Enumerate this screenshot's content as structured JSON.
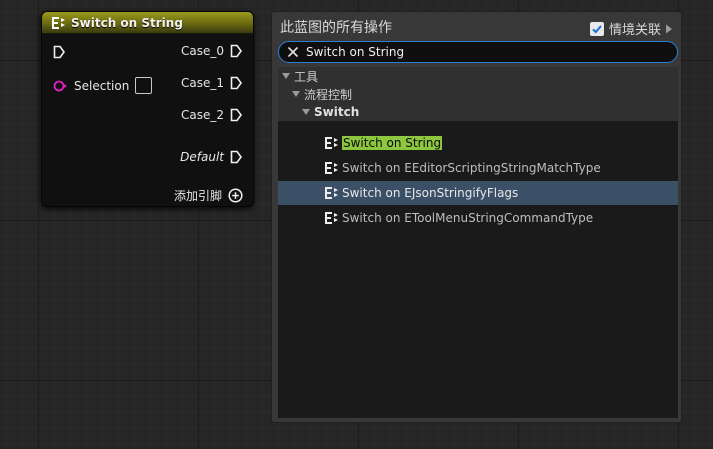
{
  "node": {
    "title": "Switch on String",
    "selection_label": "Selection",
    "cases": [
      "Case_0",
      "Case_1",
      "Case_2"
    ],
    "default_label": "Default",
    "add_pin_label": "添加引脚",
    "header_color": "#8a8a18",
    "selection_pin_color": "#e020c0"
  },
  "panel": {
    "title": "此蓝图的所有操作",
    "context_label": "情境关联",
    "context_checked": true,
    "search_value": "Switch on String",
    "tree": {
      "level1": "工具",
      "level2": "流程控制",
      "level3": "Switch",
      "items": [
        {
          "label": "Switch on String",
          "highlight": true
        },
        {
          "label": "Switch on EEditorScriptingStringMatchType"
        },
        {
          "label": "Switch on EJsonStringifyFlags",
          "selected": true
        },
        {
          "label": "Switch on EToolMenuStringCommandType"
        }
      ]
    },
    "highlight_color": "#8dc63f",
    "selected_row_color": "#3b4f66",
    "search_border_color": "#2d7fd3"
  }
}
